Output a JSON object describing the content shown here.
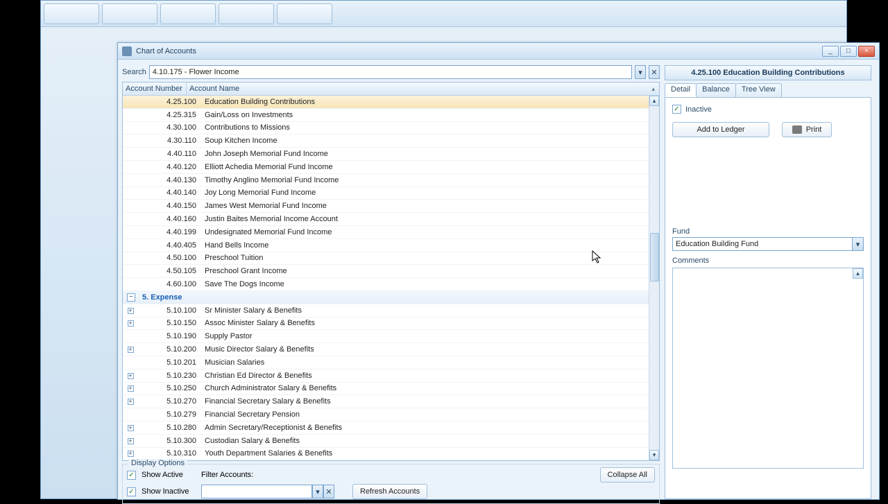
{
  "window": {
    "title": "Chart of Accounts",
    "minimize": "_",
    "maximize": "□",
    "close": "×"
  },
  "search": {
    "label": "Search",
    "value": "4.10.175 - Flower Income"
  },
  "grid": {
    "col_number": "Account Number",
    "col_name": "Account Name",
    "group_expense": "5.  Expense",
    "rows_income": [
      {
        "num": "4.25.100",
        "name": "Education Building Contributions",
        "selected": true
      },
      {
        "num": "4.25.315",
        "name": "Gain/Loss on Investments"
      },
      {
        "num": "4.30.100",
        "name": "Contributions to Missions"
      },
      {
        "num": "4.30.110",
        "name": "Soup Kitchen Income"
      },
      {
        "num": "4.40.110",
        "name": "John Joseph Memorial Fund Income"
      },
      {
        "num": "4.40.120",
        "name": "Elliott Achedia Memorial Fund Income"
      },
      {
        "num": "4.40.130",
        "name": "Timothy Anglino Memorial Fund Income"
      },
      {
        "num": "4.40.140",
        "name": "Joy Long Memorial Fund Income"
      },
      {
        "num": "4.40.150",
        "name": "James West Memorial Fund Income"
      },
      {
        "num": "4.40.160",
        "name": "Justin Baites Memorial Income Account"
      },
      {
        "num": "4.40.199",
        "name": "Undesignated Memorial Fund Income"
      },
      {
        "num": "4.40.405",
        "name": "Hand Bells Income"
      },
      {
        "num": "4.50.100",
        "name": "Preschool Tuition"
      },
      {
        "num": "4.50.105",
        "name": "Preschool Grant Income"
      },
      {
        "num": "4.60.100",
        "name": "Save The Dogs Income"
      }
    ],
    "rows_expense": [
      {
        "num": "5.10.100",
        "name": "Sr Minister Salary & Benefits",
        "expand": true
      },
      {
        "num": "5.10.150",
        "name": "Assoc Minister Salary & Benefits",
        "expand": true
      },
      {
        "num": "5.10.190",
        "name": "Supply Pastor"
      },
      {
        "num": "5.10.200",
        "name": "Music Director Salary & Benefits",
        "expand": true
      },
      {
        "num": "5.10.201",
        "name": "Musician Salaries"
      },
      {
        "num": "5.10.230",
        "name": "Christian Ed Director & Benefits",
        "expand": true
      },
      {
        "num": "5.10.250",
        "name": "Church Administrator Salary & Benefits",
        "expand": true
      },
      {
        "num": "5.10.270",
        "name": "Financial Secretary Salary & Benefits",
        "expand": true
      },
      {
        "num": "5.10.279",
        "name": "Financial Secretary Pension"
      },
      {
        "num": "5.10.280",
        "name": "Admin Secretary/Receptionist & Benefits",
        "expand": true
      },
      {
        "num": "5.10.300",
        "name": "Custodian Salary & Benefits",
        "expand": true
      },
      {
        "num": "5.10.310",
        "name": "Youth Department Salaries & Benefits",
        "expand": true
      }
    ]
  },
  "display": {
    "legend": "Display Options",
    "show_active": "Show Active",
    "show_inactive": "Show Inactive",
    "filter_label": "Filter Accounts:",
    "collapse": "Collapse All",
    "refresh": "Refresh Accounts"
  },
  "detail": {
    "header": "4.25.100 Education Building Contributions",
    "tabs": {
      "detail": "Detail",
      "balance": "Balance",
      "tree": "Tree View"
    },
    "inactive": "Inactive",
    "add_ledger": "Add to Ledger",
    "print": "Print",
    "fund_label": "Fund",
    "fund_value": "Education Building Fund",
    "comments_label": "Comments"
  }
}
